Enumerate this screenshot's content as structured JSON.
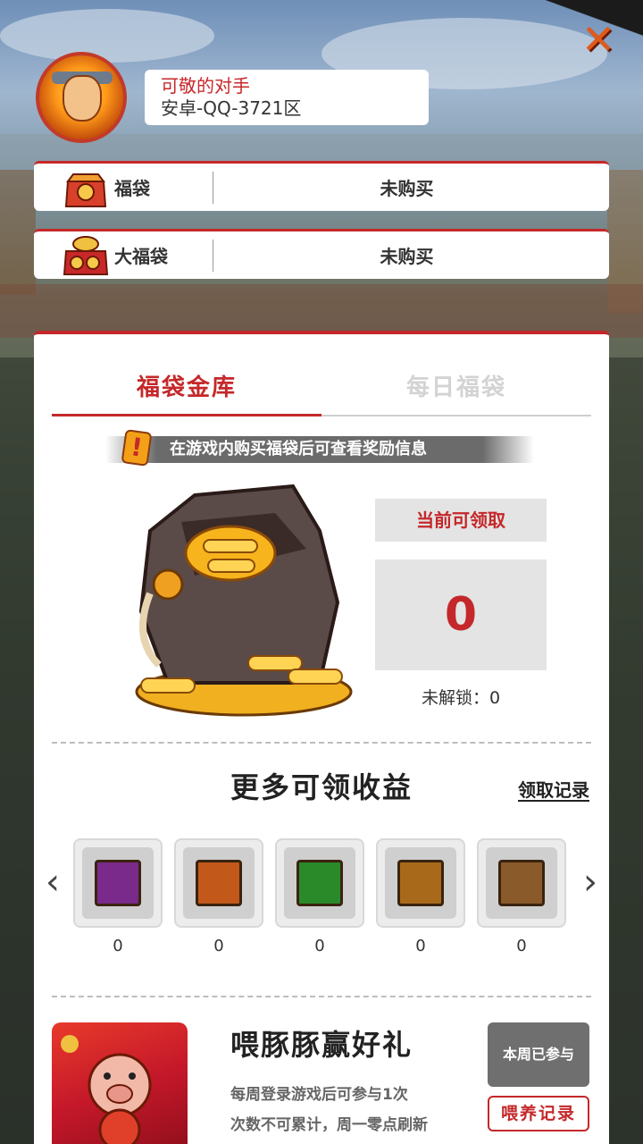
{
  "profile": {
    "name": "可敬的对手",
    "server": "安卓-QQ-3721区"
  },
  "bags": [
    {
      "label": "福袋",
      "status": "未购买",
      "icon": "lucky-bag-icon"
    },
    {
      "label": "大福袋",
      "status": "未购买",
      "icon": "big-lucky-bag-icon"
    }
  ],
  "tabs": [
    {
      "label": "福袋金库",
      "active": true
    },
    {
      "label": "每日福袋",
      "active": false
    }
  ],
  "notice": {
    "text": "在游戏内购买福袋后可查看奖励信息",
    "icon": "warning-icon",
    "glyph": "!"
  },
  "vault": {
    "claim_label": "当前可领取",
    "claim_value": "0",
    "locked_text": "未解锁：0"
  },
  "more": {
    "title": "更多可领收益",
    "record_link": "领取记录",
    "prev_arrow": "‹",
    "next_arrow": "›",
    "rewards": [
      {
        "icon": "taiji-stone-icon",
        "count": "0",
        "color": "#7a2a8a"
      },
      {
        "icon": "ramen-bowl-icon",
        "count": "0",
        "color": "#c2581a"
      },
      {
        "icon": "green-frog-icon",
        "count": "0",
        "color": "#2a8a2a"
      },
      {
        "icon": "copper-coin-icon",
        "count": "0",
        "color": "#a86a1a"
      },
      {
        "icon": "mystery-item-icon",
        "count": "0",
        "color": "#8a5a2a"
      }
    ]
  },
  "event": {
    "title": "喂豚豚赢好礼",
    "desc1": "每周登录游戏后可参与1次",
    "desc2": "次数不可累计，周一零点刷新",
    "participated_label": "本周已参与",
    "feed_record_label": "喂养记录"
  },
  "close_glyph": "✕"
}
